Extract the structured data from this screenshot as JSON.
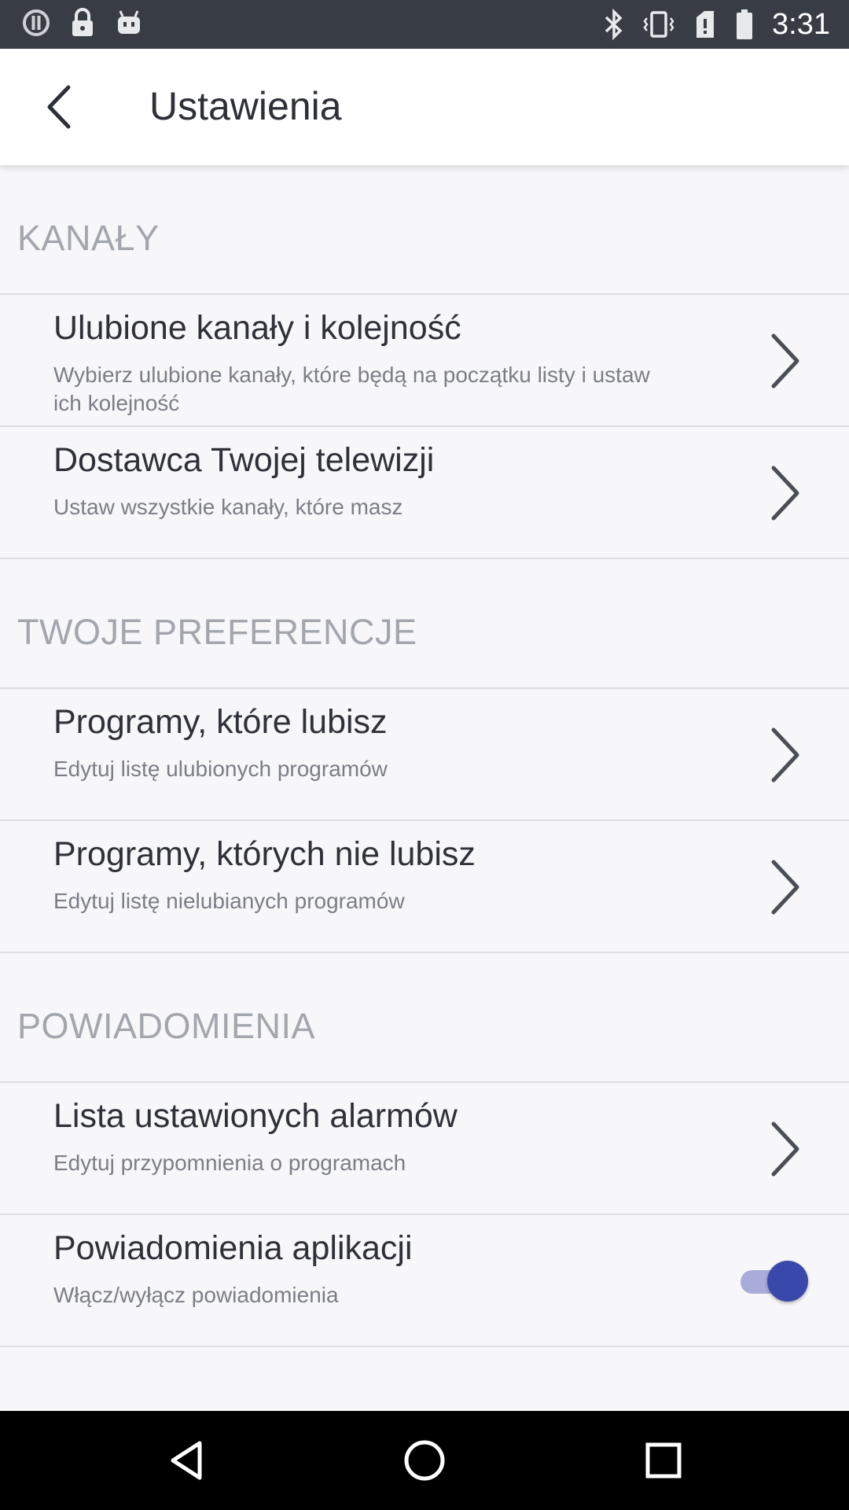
{
  "status_bar": {
    "time": "3:31",
    "left_icons": [
      "alert-circle-icon",
      "lock-icon",
      "android-icon"
    ],
    "right_icons": [
      "bluetooth-icon",
      "vibrate-icon",
      "signal-off-icon",
      "battery-icon"
    ]
  },
  "app_bar": {
    "back_icon": "chevron-left-icon",
    "title": "Ustawienia"
  },
  "sections": [
    {
      "header": "KANAŁY",
      "items": [
        {
          "title": "Ulubione kanały i kolejność",
          "subtitle": "Wybierz ulubione kanały, które będą na początku listy i ustaw ich kolejność",
          "control": "chevron"
        },
        {
          "title": "Dostawca Twojej telewizji",
          "subtitle": "Ustaw wszystkie kanały, które masz",
          "control": "chevron"
        }
      ]
    },
    {
      "header": "TWOJE PREFERENCJE",
      "items": [
        {
          "title": "Programy, które lubisz",
          "subtitle": "Edytuj listę ulubionych programów",
          "control": "chevron"
        },
        {
          "title": "Programy, których nie lubisz",
          "subtitle": "Edytuj listę nielubianych programów",
          "control": "chevron"
        }
      ]
    },
    {
      "header": "POWIADOMIENIA",
      "items": [
        {
          "title": "Lista ustawionych alarmów",
          "subtitle": "Edytuj przypomnienia o programach",
          "control": "chevron"
        },
        {
          "title": "Powiadomienia aplikacji",
          "subtitle": "Włącz/wyłącz powiadomienia",
          "control": "toggle",
          "toggle_on": true
        }
      ]
    }
  ],
  "colors": {
    "status_bar": "#383c45",
    "accent": "#3949ab",
    "section_header": "#a3a6ad"
  },
  "nav_bar": {
    "icons": [
      "back-triangle-icon",
      "home-circle-icon",
      "recents-square-icon"
    ]
  }
}
